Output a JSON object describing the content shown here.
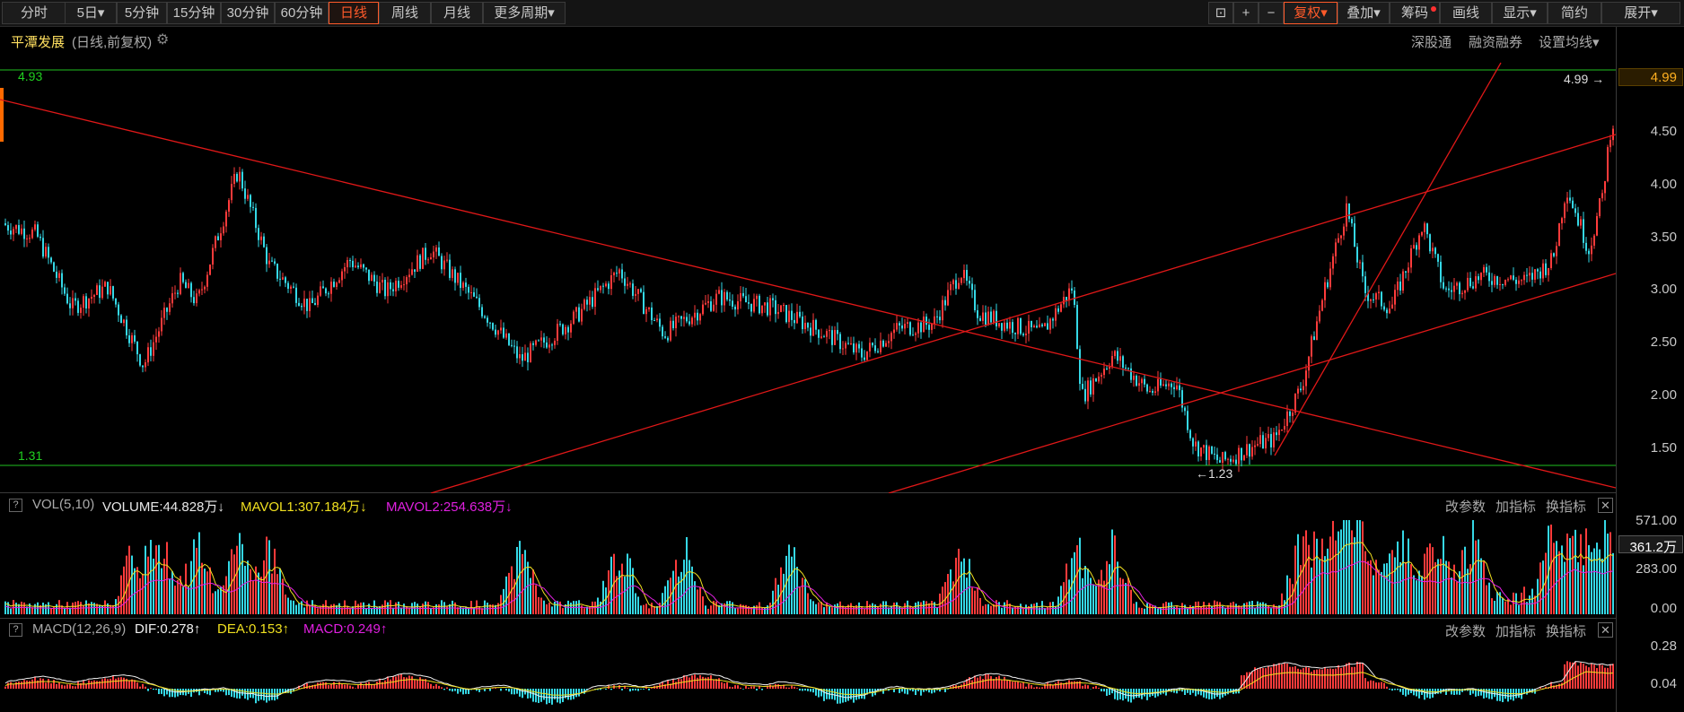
{
  "toolbar": {
    "left": [
      {
        "label": "分时"
      },
      {
        "label": "5日▾"
      },
      {
        "label": "5分钟"
      },
      {
        "label": "15分钟"
      },
      {
        "label": "30分钟"
      },
      {
        "label": "60分钟"
      },
      {
        "label": "日线",
        "active": true
      },
      {
        "label": "周线"
      },
      {
        "label": "月线"
      },
      {
        "label": "更多周期▾"
      }
    ],
    "right": [
      {
        "label": "⊡"
      },
      {
        "label": "+"
      },
      {
        "label": "−"
      },
      {
        "label": "复权▾",
        "highlight": true
      },
      {
        "label": "叠加▾"
      },
      {
        "label": "筹码",
        "dot": true
      },
      {
        "label": "画线"
      },
      {
        "label": "显示▾"
      },
      {
        "label": "简约"
      },
      {
        "label": "展开▾"
      }
    ]
  },
  "stock": {
    "name": "平潭发展",
    "mode": "(日线,前复权)",
    "links": [
      "深股通",
      "融资融券",
      "设置均线▾"
    ]
  },
  "price_panel": {
    "labels": {
      "top_left": "4.93",
      "bottom_left": "1.31",
      "high_marker": "4.99 →",
      "low_marker": "←1.23"
    },
    "axis": [
      "4.99",
      "4.50",
      "4.00",
      "3.50",
      "3.00",
      "2.50",
      "2.00",
      "1.50"
    ],
    "current_price": "4.99"
  },
  "volume_panel": {
    "help": "?",
    "name": "VOL(5,10)",
    "volume": "VOLUME:44.828万↓",
    "mavol1": "MAVOL1:307.184万↓",
    "mavol2": "MAVOL2:254.638万↓",
    "actions": [
      "改参数",
      "加指标",
      "换指标"
    ],
    "axis": [
      "571.00",
      "283.00",
      "0.00"
    ],
    "current": "361.2万"
  },
  "macd_panel": {
    "help": "?",
    "name": "MACD(12,26,9)",
    "dif": "DIF:0.278↑",
    "dea": "DEA:0.153↑",
    "macd": "MACD:0.249↑",
    "actions": [
      "改参数",
      "加指标",
      "换指标"
    ],
    "axis": [
      "0.28",
      "0.04"
    ]
  },
  "colors": {
    "up": "#ff3b3b",
    "down": "#35d8e6",
    "trend": "#e01818",
    "hline": "#20c020",
    "ma1": "#f0e020",
    "ma2": "#e020e0",
    "dif": "#f0f0f0",
    "dea": "#f0e020"
  },
  "icons": [
    "lock-icon",
    "zoom-in-icon",
    "zoom-out-icon",
    "close-icon",
    "settings-gear-icon",
    "help-icon"
  ]
}
